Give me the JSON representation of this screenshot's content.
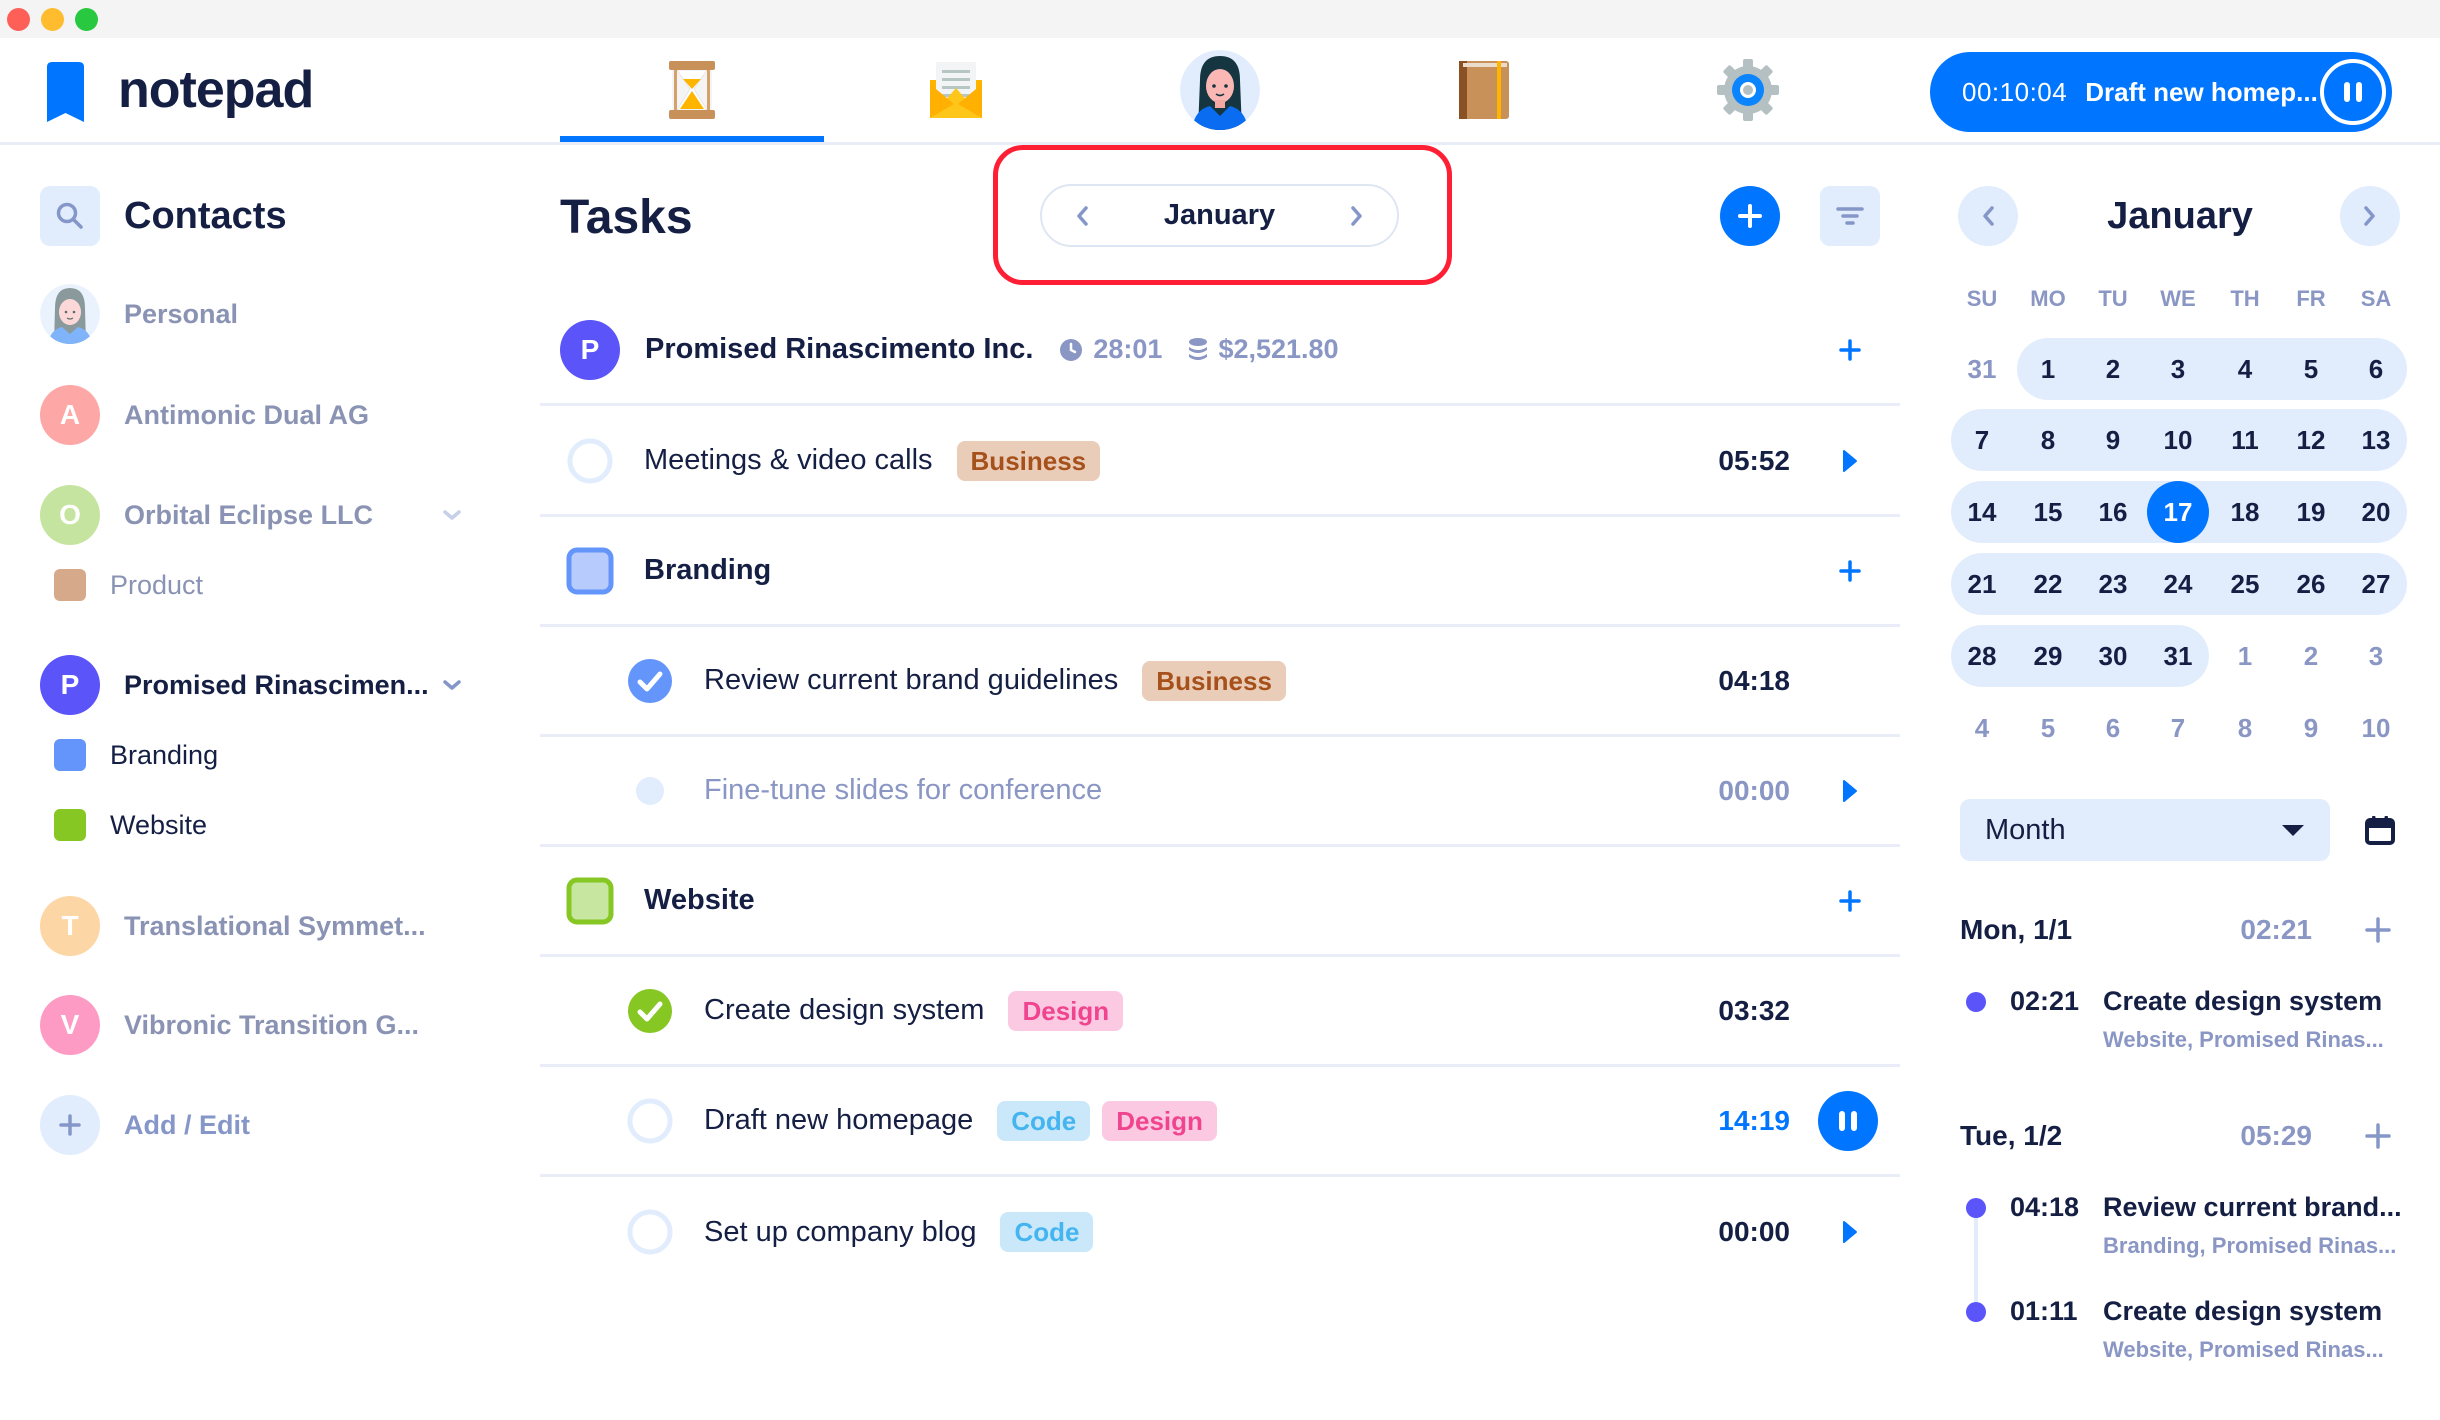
{
  "app": {
    "name": "notepad",
    "accent": "#0075ff"
  },
  "window_controls": [
    "close",
    "minimize",
    "maximize"
  ],
  "nav": {
    "tabs": [
      {
        "id": "timer",
        "icon": "hourglass-icon",
        "active": true
      },
      {
        "id": "mail",
        "icon": "envelope-icon",
        "active": false
      },
      {
        "id": "profile",
        "icon": "avatar-icon",
        "active": false
      },
      {
        "id": "notebook",
        "icon": "book-icon",
        "active": false
      },
      {
        "id": "settings",
        "icon": "gear-icon",
        "active": false
      }
    ]
  },
  "timer": {
    "elapsed": "00:10:04",
    "task": "Draft new homep...",
    "state": "running"
  },
  "sidebar": {
    "title": "Contacts",
    "items": [
      {
        "label": "Personal",
        "avatar": "photo",
        "color": "#e1edfd"
      },
      {
        "label": "Antimonic Dual AG",
        "initial": "A",
        "color": "#fda7a7"
      },
      {
        "label": "Orbital Eclipse LLC",
        "initial": "O",
        "color": "#c5e4a0",
        "expandable": true
      },
      {
        "label": "Product",
        "project": true,
        "color": "#d6a98a"
      },
      {
        "label": "Promised Rinascimen...",
        "initial": "P",
        "color": "#5a54f9",
        "expandable": true,
        "active": true
      },
      {
        "label": "Branding",
        "project": true,
        "color": "#6395fb"
      },
      {
        "label": "Website",
        "project": true,
        "color": "#86c724"
      },
      {
        "label": "Translational Symmet...",
        "initial": "T",
        "color": "#fdd6a6"
      },
      {
        "label": "Vibronic Transition G...",
        "initial": "V",
        "color": "#fe9bc4"
      }
    ],
    "add_edit_label": "Add / Edit"
  },
  "tasks": {
    "title": "Tasks",
    "period_label": "January",
    "client": {
      "initial": "P",
      "name": "Promised Rinascimento Inc.",
      "time": "28:01",
      "amount": "$2,521.80"
    },
    "rows": [
      {
        "type": "task",
        "title": "Meetings & video calls",
        "tags": [
          "Business"
        ],
        "duration": "05:52",
        "status": "open",
        "action": "play"
      },
      {
        "type": "project",
        "title": "Branding",
        "color": "#6395fb"
      },
      {
        "type": "task",
        "title": "Review current brand guidelines",
        "tags": [
          "Business"
        ],
        "duration": "04:18",
        "status": "done",
        "action": "none"
      },
      {
        "type": "task",
        "title": "Fine-tune slides for conference",
        "tags": [],
        "duration": "00:00",
        "status": "placeholder",
        "action": "play"
      },
      {
        "type": "project",
        "title": "Website",
        "color": "#86c724"
      },
      {
        "type": "task",
        "title": "Create design system",
        "tags": [
          "Design"
        ],
        "duration": "03:32",
        "status": "done",
        "action": "none"
      },
      {
        "type": "task",
        "title": "Draft new homepage",
        "tags": [
          "Code",
          "Design"
        ],
        "duration": "14:19",
        "status": "running",
        "action": "pause"
      },
      {
        "type": "task",
        "title": "Set up company blog",
        "tags": [
          "Code"
        ],
        "duration": "00:00",
        "status": "open",
        "action": "play"
      }
    ]
  },
  "calendar": {
    "month": "January",
    "weekdays": [
      "SU",
      "MO",
      "TU",
      "WE",
      "TH",
      "FR",
      "SA"
    ],
    "weeks": [
      [
        "31",
        "1",
        "2",
        "3",
        "4",
        "5",
        "6"
      ],
      [
        "7",
        "8",
        "9",
        "10",
        "11",
        "12",
        "13"
      ],
      [
        "14",
        "15",
        "16",
        "17",
        "18",
        "19",
        "20"
      ],
      [
        "21",
        "22",
        "23",
        "24",
        "25",
        "26",
        "27"
      ],
      [
        "28",
        "29",
        "30",
        "31",
        "1",
        "2",
        "3"
      ],
      [
        "4",
        "5",
        "6",
        "7",
        "8",
        "9",
        "10"
      ]
    ],
    "today": "17",
    "view_select": "Month"
  },
  "agenda": [
    {
      "date": "Mon, 1/1",
      "total": "02:21",
      "entries": [
        {
          "time": "02:21",
          "title": "Create design system",
          "sub": "Website, Promised Rinas..."
        }
      ]
    },
    {
      "date": "Tue, 1/2",
      "total": "05:29",
      "entries": [
        {
          "time": "04:18",
          "title": "Review current brand...",
          "sub": "Branding, Promised Rinas..."
        },
        {
          "time": "01:11",
          "title": "Create design system",
          "sub": "Website, Promised Rinas..."
        }
      ]
    }
  ]
}
